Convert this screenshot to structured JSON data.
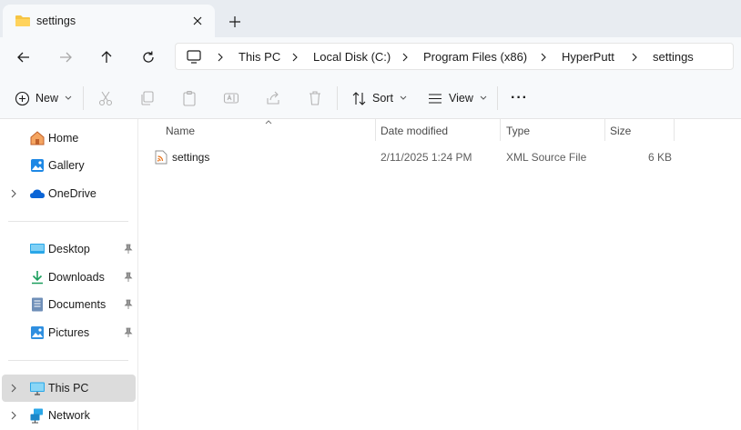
{
  "tab": {
    "title": "settings",
    "folder_icon": "folder-icon",
    "close_icon": "close-icon"
  },
  "newtab_icon": "plus-icon",
  "nav": {
    "back_icon": "arrow-left-icon",
    "forward_icon": "arrow-right-icon",
    "up_icon": "arrow-up-icon",
    "refresh_icon": "refresh-icon"
  },
  "address": {
    "root_icon": "monitor-icon",
    "crumbs": [
      "This PC",
      "Local Disk (C:)",
      "Program Files (x86)",
      "HyperPutt",
      "settings"
    ]
  },
  "commands": {
    "new_label": "New",
    "sort_label": "Sort",
    "view_label": "View",
    "more_label": "···"
  },
  "sidebar": {
    "items": [
      {
        "label": "Home",
        "icon": "home-icon"
      },
      {
        "label": "Gallery",
        "icon": "gallery-icon"
      },
      {
        "label": "OneDrive",
        "icon": "cloud-icon"
      },
      {
        "label": "Desktop",
        "icon": "desktop-icon"
      },
      {
        "label": "Downloads",
        "icon": "download-icon"
      },
      {
        "label": "Documents",
        "icon": "documents-icon"
      },
      {
        "label": "Pictures",
        "icon": "pictures-icon"
      },
      {
        "label": "This PC",
        "icon": "monitor-icon"
      },
      {
        "label": "Network",
        "icon": "network-icon"
      }
    ]
  },
  "columns": {
    "name": "Name",
    "date": "Date modified",
    "type": "Type",
    "size": "Size"
  },
  "files": [
    {
      "name": "settings",
      "date": "2/11/2025 1:24 PM",
      "type": "XML Source File",
      "size": "6 KB",
      "icon": "xml-file-icon"
    }
  ],
  "colors": {
    "folder": "#f6c443",
    "accent": "#0067c0",
    "selected": "#dcdcdc",
    "rss": "#e8731a"
  }
}
